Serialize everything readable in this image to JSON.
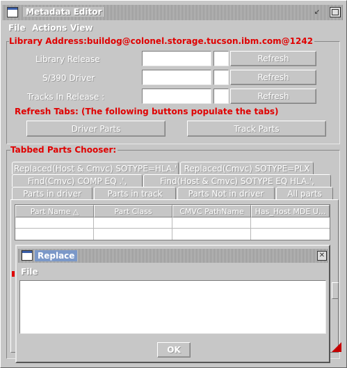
{
  "main_window": {
    "title": "Metadata Editor",
    "menu": [
      "File",
      "Actions",
      "View"
    ]
  },
  "library": {
    "address_label": "Library Address:buildog@colonel.storage.tucson.ibm.com@1242",
    "rows": [
      {
        "label": "Library Release",
        "value": "",
        "button": "Refresh"
      },
      {
        "label": "S/390 Driver",
        "value": "",
        "button": "Refresh"
      },
      {
        "label": "Tracks In Release :",
        "value": "",
        "button": "Refresh"
      }
    ]
  },
  "refresh_tabs": {
    "label": "Refresh Tabs: (The following buttons populate the tabs)",
    "driver_parts": "Driver Parts",
    "track_parts": "Track Parts"
  },
  "chooser": {
    "label": "Tabbed Parts Chooser:",
    "tabs_row1": [
      "Replaced(Host & Cmvc) SOTYPE=HLA.'",
      "Replaced(Cmvc) SOTYPE=PLX"
    ],
    "tabs_row2": [
      "Find(Cmvc) COMP EQ .',",
      "Find(Host & Cmvc) SOTYPE EQ HLA.',"
    ],
    "tabs_row3": [
      "Parts in driver",
      "Parts in track",
      "Parts Not in driver",
      "All parts"
    ],
    "columns": [
      "Part Name △",
      "Part Class",
      "CMVC PathName",
      "Has_Host MDE U..."
    ]
  },
  "dialog": {
    "title": "Replace",
    "menu": [
      "File"
    ],
    "text": "",
    "ok": "OK"
  }
}
